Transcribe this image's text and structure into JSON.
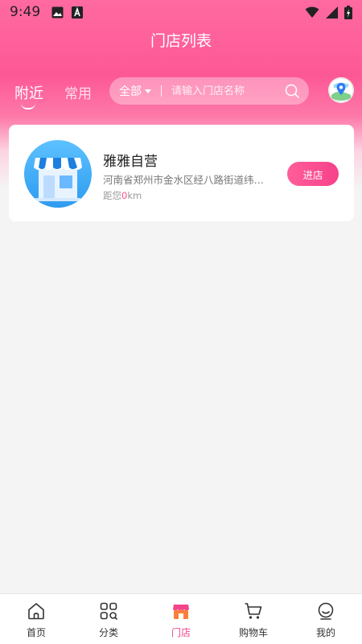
{
  "status_bar": {
    "time": "9:49"
  },
  "header": {
    "title": "门店列表"
  },
  "tabs": [
    {
      "label": "附近",
      "active": true
    },
    {
      "label": "常用",
      "active": false
    }
  ],
  "search": {
    "filter_label": "全部",
    "placeholder": "请输入门店名称",
    "value": ""
  },
  "stores": [
    {
      "name": "雅雅自营",
      "address": "河南省郑州市金水区经八路街道纬…",
      "distance_prefix": "距您",
      "distance_value": "0",
      "distance_unit": "km",
      "enter_label": "进店"
    }
  ],
  "bottom_nav": [
    {
      "label": "首页",
      "icon": "home-icon",
      "active": false
    },
    {
      "label": "分类",
      "icon": "category-icon",
      "active": false
    },
    {
      "label": "门店",
      "icon": "store-icon",
      "active": true
    },
    {
      "label": "购物车",
      "icon": "cart-icon",
      "active": false
    },
    {
      "label": "我的",
      "icon": "profile-icon",
      "active": false
    }
  ],
  "colors": {
    "accent": "#f2458a",
    "header_pink": "#fd5896",
    "background": "#f4f4f5"
  }
}
